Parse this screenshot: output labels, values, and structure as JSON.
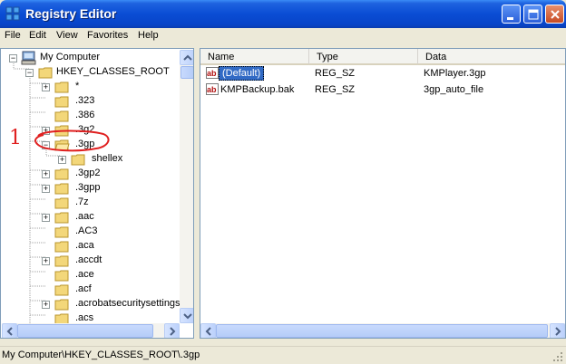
{
  "window": {
    "title": "Registry Editor"
  },
  "menu": [
    "File",
    "Edit",
    "View",
    "Favorites",
    "Help"
  ],
  "tree": {
    "root": "My Computer",
    "hive": "HKEY_CLASSES_ROOT",
    "items": [
      "*",
      ".323",
      ".386",
      ".3g2",
      ".3gp",
      "shellex",
      ".3gp2",
      ".3gpp",
      ".7z",
      ".aac",
      ".AC3",
      ".aca",
      ".accdt",
      ".ace",
      ".acf",
      ".acrobatsecuritysettings",
      ".acs"
    ]
  },
  "list": {
    "columns": [
      "Name",
      "Type",
      "Data"
    ],
    "rows": [
      {
        "name": "(Default)",
        "type": "REG_SZ",
        "data": "KMPlayer.3gp",
        "icon": "string-value-icon"
      },
      {
        "name": "KMPBackup.bak",
        "type": "REG_SZ",
        "data": "3gp_auto_file",
        "icon": "string-value-icon"
      }
    ]
  },
  "status": "My Computer\\HKEY_CLASSES_ROOT\\.3gp",
  "annotation": {
    "number": "1",
    "color": "#E02020"
  },
  "colors": {
    "titlebar": "#0A4DD4",
    "selection": "#316AC5",
    "folder": "#F3D77A"
  }
}
